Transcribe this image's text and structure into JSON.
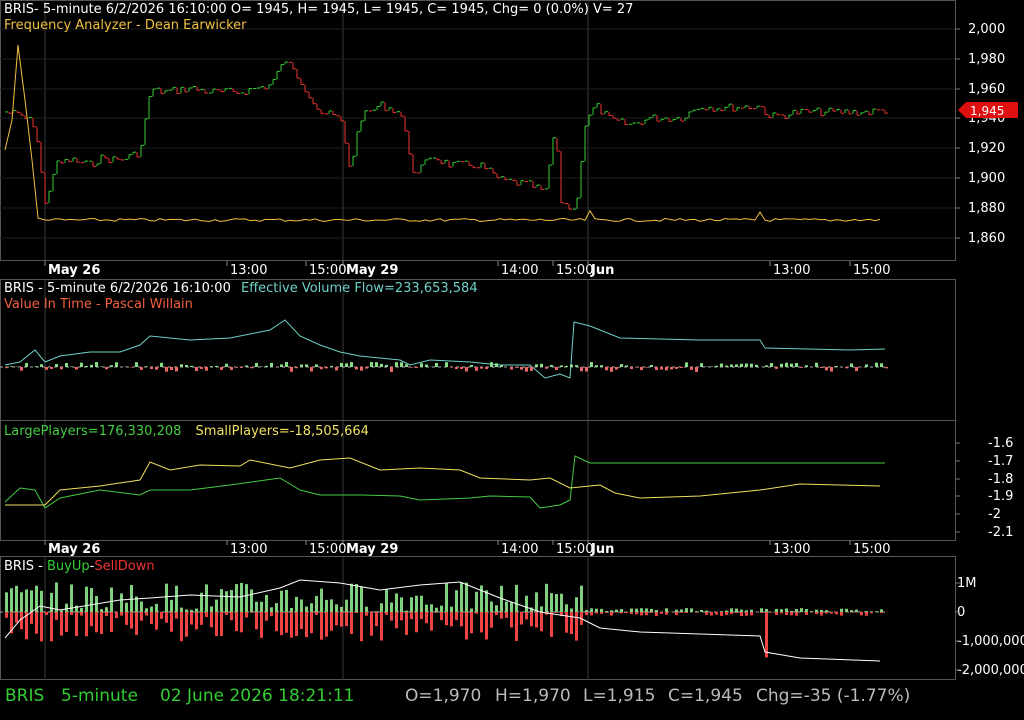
{
  "panel1": {
    "header_line1": "BRIS- 5-minute 6/2/2026 16:10:00 O= 1945, H= 1945, L= 1945, C= 1945, Chg= 0 (0.0%) V= 27",
    "header_line2": "Frequency Analyzer - Dean Earwicker",
    "y_ticks": [
      "2,000",
      "1,980",
      "1,960",
      "1,940",
      "1,920",
      "1,900",
      "1,880",
      "1,860"
    ],
    "last_price_label": "1,945"
  },
  "time_axis": {
    "labels": [
      "May 26",
      "13:00",
      "15:00",
      "May 29",
      "14:00",
      "15:00",
      "Jun",
      "13:00",
      "15:00"
    ],
    "bold": [
      true,
      false,
      false,
      true,
      false,
      false,
      true,
      false,
      false
    ]
  },
  "panel2": {
    "title": "BRIS - 5-minute  6/2/2026 16:10:00",
    "series_label": "Effective Volume Flow=233,653,584",
    "indicator_label": "Value In Time - Pascal Willain"
  },
  "panel3": {
    "large_label": "LargePlayers=176,330,208",
    "small_label": "SmallPlayers=-18,505,664",
    "y_ticks": [
      "-1.6",
      "-1.7",
      "-1.8",
      "-1.9",
      "-2",
      "-2.1"
    ]
  },
  "panel4": {
    "title_prefix": "BRIS - ",
    "buy_label": "BuyUp",
    "sep": "-",
    "sell_label": "SellDown",
    "y_ticks": [
      "1M",
      "0",
      "-1,000,000",
      "-2,000,000"
    ]
  },
  "status": {
    "symbol": "BRIS",
    "interval": "5-minute",
    "datetime": "02 June 2026 18:21:11",
    "open": "O=1,970",
    "high": "H=1,970",
    "low": "L=1,915",
    "close": "C=1,945",
    "change": "Chg=-35 (-1.77%)"
  },
  "colors": {
    "up": "#33cc33",
    "down": "#ee3333",
    "freq": "#f0c040",
    "evf": "#6fd0c8",
    "large": "#44cc44",
    "small": "#f0e060",
    "grid": "#333333",
    "axis_text": "#ffffff"
  }
}
